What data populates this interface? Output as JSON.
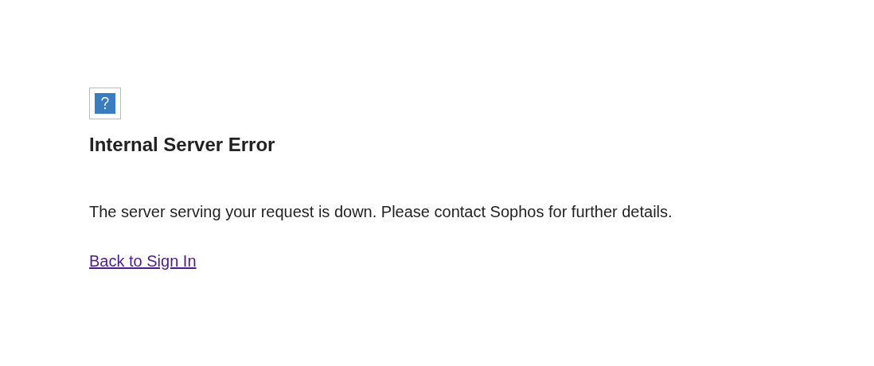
{
  "heading": "Internal Server Error",
  "message": "The server serving your request is down. Please contact Sophos for further details.",
  "link": {
    "label": "Back to Sign In"
  }
}
